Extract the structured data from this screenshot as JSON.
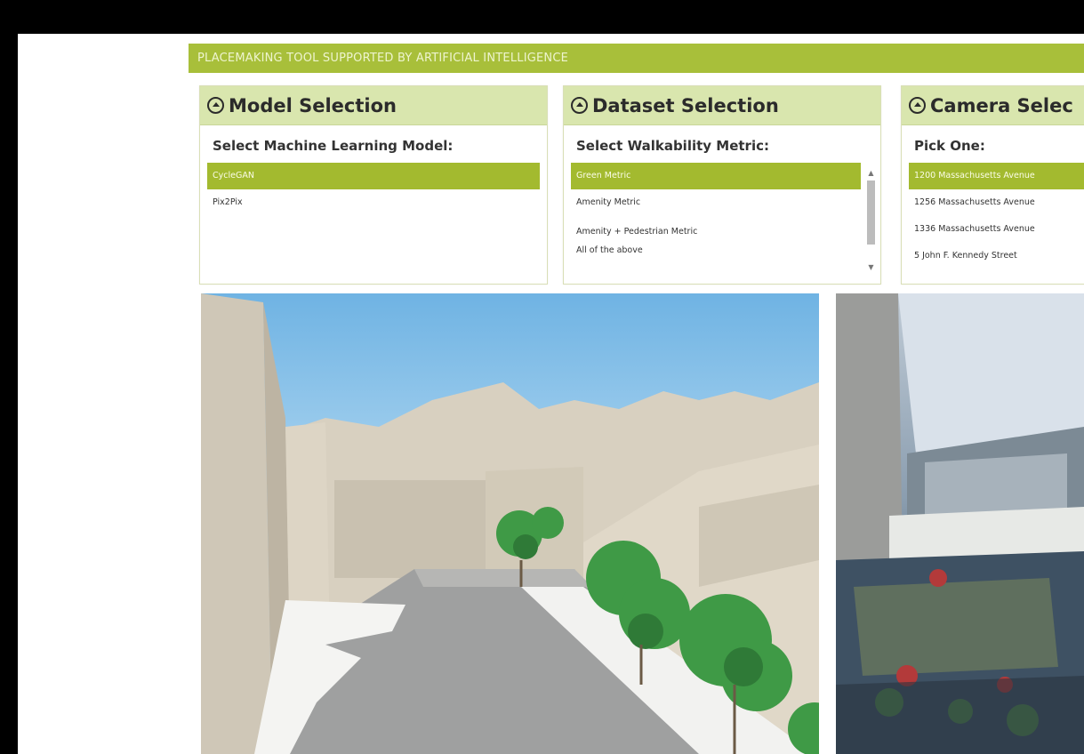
{
  "banner": {
    "title": "PLACEMAKING TOOL SUPPORTED BY ARTIFICIAL INTELLIGENCE"
  },
  "model_panel": {
    "title": "Model Selection",
    "label": "Select Machine Learning Model:",
    "options": [
      "CycleGAN",
      "Pix2Pix"
    ],
    "selected": "CycleGAN"
  },
  "dataset_panel": {
    "title": "Dataset Selection",
    "label": "Select Walkability Metric:",
    "options": [
      "Green Metric",
      "Amenity Metric",
      "Amenity + Pedestrian Metric",
      "All of the above"
    ],
    "selected": "Green Metric"
  },
  "camera_panel": {
    "title": "Camera Selec",
    "label": "Pick One:",
    "options": [
      "1200 Massachusetts Avenue",
      "1256 Massachusetts Avenue",
      "1336 Massachusetts Avenue",
      "5 John F. Kennedy Street"
    ],
    "selected": "1200 Massachusetts Avenue"
  },
  "colors": {
    "accent": "#a3ba2f",
    "panel_header": "#d9e6ae",
    "banner": "#a8bf3a"
  }
}
